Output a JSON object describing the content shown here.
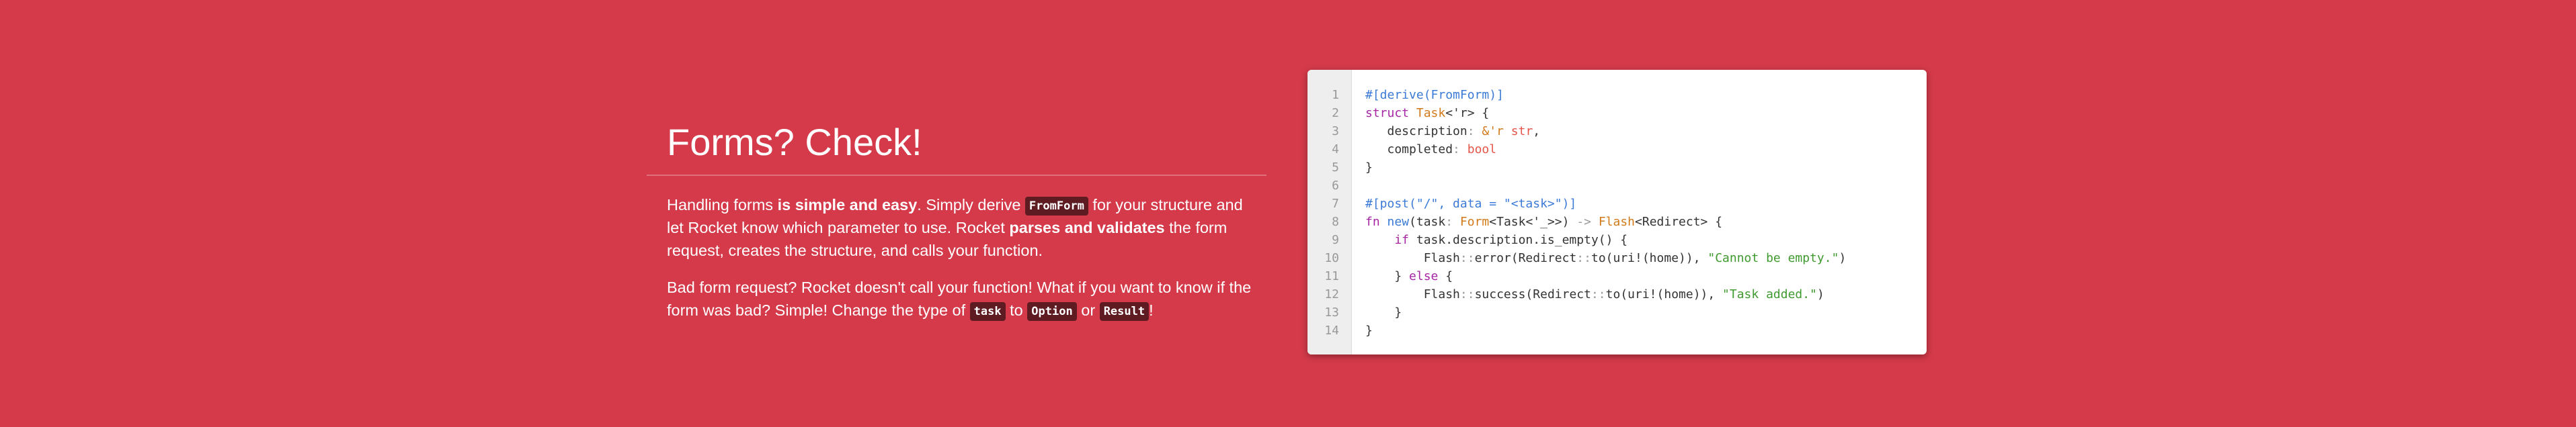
{
  "section": {
    "title": "Forms? Check!",
    "paragraph1": [
      {
        "type": "text",
        "text": "Handling forms "
      },
      {
        "type": "bold",
        "text": "is simple and easy"
      },
      {
        "type": "text",
        "text": ". Simply derive "
      },
      {
        "type": "code",
        "text": "FromForm"
      },
      {
        "type": "text",
        "text": " for your structure and let Rocket know which parameter to use. Rocket "
      },
      {
        "type": "bold",
        "text": "parses and validates"
      },
      {
        "type": "text",
        "text": " the form request, creates the structure, and calls your function."
      }
    ],
    "paragraph2": [
      {
        "type": "text",
        "text": "Bad form request? Rocket doesn't call your function! What if you want to know if the form was bad? Simple! Change the type of "
      },
      {
        "type": "code",
        "text": "task"
      },
      {
        "type": "text",
        "text": " to "
      },
      {
        "type": "code",
        "text": "Option"
      },
      {
        "type": "text",
        "text": " or "
      },
      {
        "type": "code",
        "text": "Result"
      },
      {
        "type": "text",
        "text": "!"
      }
    ]
  },
  "code_block": {
    "line_numbers": [
      "1",
      "2",
      "3",
      "4",
      "5",
      "6",
      "7",
      "8",
      "9",
      "10",
      "11",
      "12",
      "13",
      "14"
    ],
    "lines": [
      [
        {
          "c": "attr",
          "t": "#[derive(FromForm)]"
        }
      ],
      [
        {
          "c": "kw",
          "t": "struct "
        },
        {
          "c": "type",
          "t": "Task"
        },
        {
          "c": "plain",
          "t": "<'r> {"
        }
      ],
      [
        {
          "c": "field",
          "t": "   description"
        },
        {
          "c": "punc",
          "t": ": "
        },
        {
          "c": "type",
          "t": "&'r "
        },
        {
          "c": "prim",
          "t": "str"
        },
        {
          "c": "plain",
          "t": ","
        }
      ],
      [
        {
          "c": "field",
          "t": "   completed"
        },
        {
          "c": "punc",
          "t": ": "
        },
        {
          "c": "prim",
          "t": "bool"
        }
      ],
      [
        {
          "c": "plain",
          "t": "}"
        }
      ],
      [
        {
          "c": "plain",
          "t": ""
        }
      ],
      [
        {
          "c": "attr",
          "t": "#[post(\"/\", data = \"<task>\")]"
        }
      ],
      [
        {
          "c": "kw",
          "t": "fn "
        },
        {
          "c": "attr",
          "t": "new"
        },
        {
          "c": "plain",
          "t": "(task"
        },
        {
          "c": "punc",
          "t": ": "
        },
        {
          "c": "type",
          "t": "Form"
        },
        {
          "c": "plain",
          "t": "<Task<'_>>) "
        },
        {
          "c": "punc",
          "t": "-> "
        },
        {
          "c": "type",
          "t": "Flash"
        },
        {
          "c": "plain",
          "t": "<Redirect> {"
        }
      ],
      [
        {
          "c": "kw",
          "t": "    if "
        },
        {
          "c": "plain",
          "t": "task.description.is_empty() {"
        }
      ],
      [
        {
          "c": "plain",
          "t": "        Flash"
        },
        {
          "c": "punc",
          "t": "::"
        },
        {
          "c": "plain",
          "t": "error(Redirect"
        },
        {
          "c": "punc",
          "t": "::"
        },
        {
          "c": "plain",
          "t": "to(uri!(home)), "
        },
        {
          "c": "str",
          "t": "\"Cannot be empty.\""
        },
        {
          "c": "plain",
          "t": ")"
        }
      ],
      [
        {
          "c": "plain",
          "t": "    } "
        },
        {
          "c": "kw",
          "t": "else"
        },
        {
          "c": "plain",
          "t": " {"
        }
      ],
      [
        {
          "c": "plain",
          "t": "        Flash"
        },
        {
          "c": "punc",
          "t": "::"
        },
        {
          "c": "plain",
          "t": "success(Redirect"
        },
        {
          "c": "punc",
          "t": "::"
        },
        {
          "c": "plain",
          "t": "to(uri!(home)), "
        },
        {
          "c": "str",
          "t": "\"Task added.\""
        },
        {
          "c": "plain",
          "t": ")"
        }
      ],
      [
        {
          "c": "plain",
          "t": "    }"
        }
      ],
      [
        {
          "c": "plain",
          "t": "}"
        }
      ]
    ]
  },
  "colors": {
    "background": "#d43a4a",
    "code_chip": "#5e1b22",
    "attr": "#3b7ad6",
    "keyword": "#a626a4",
    "type": "#d27a1a",
    "primitive": "#e45649",
    "string": "#3f9a2f"
  }
}
